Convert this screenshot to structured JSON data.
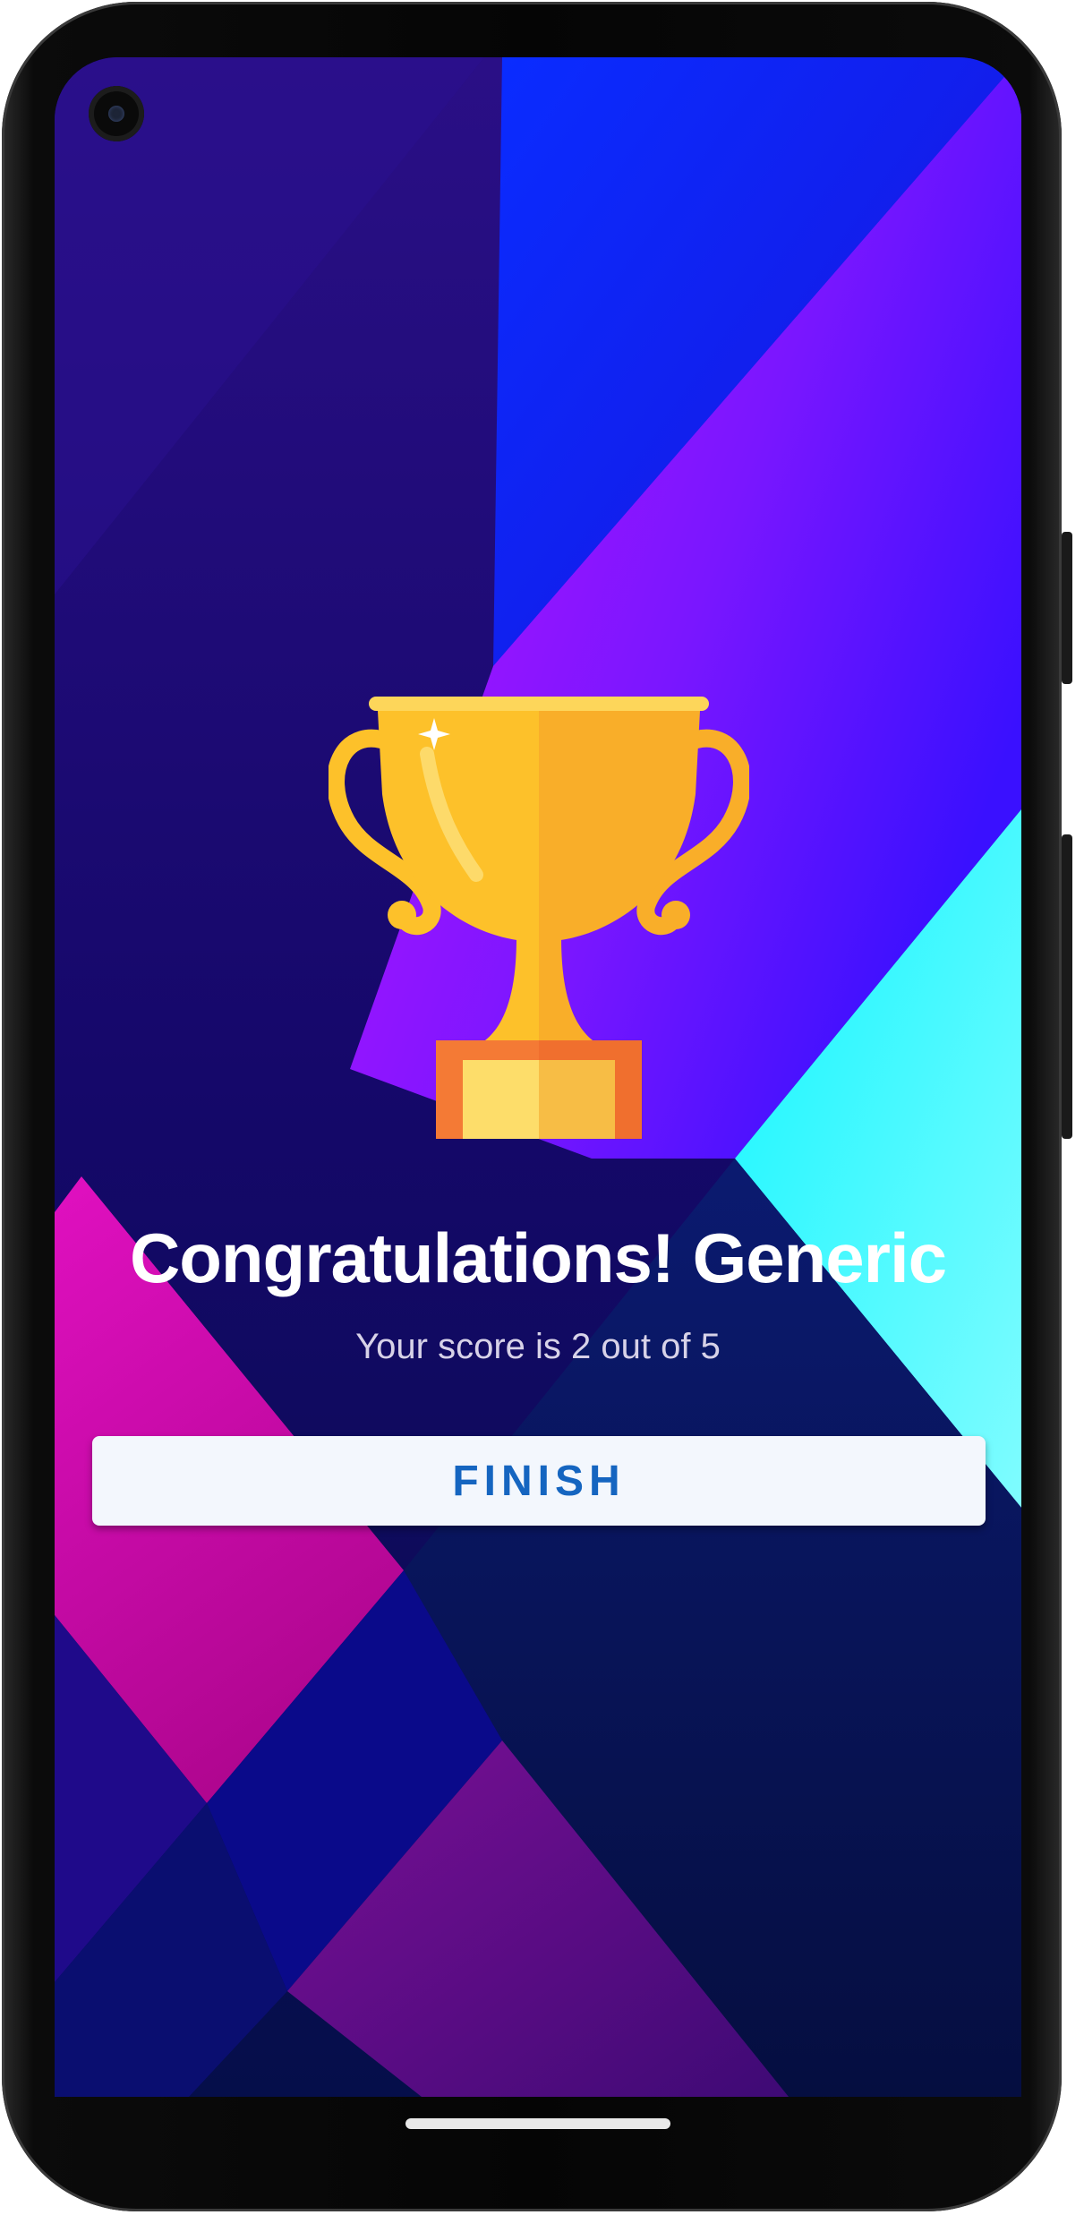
{
  "screen": {
    "title": "Congratulations! Generic",
    "score_text": "Your score is 2 out of 5",
    "finish_label": "FINISH"
  },
  "icons": {
    "trophy": "trophy-icon",
    "camera": "front-camera",
    "home": "home-indicator"
  },
  "colors": {
    "background": "#0d0650",
    "trophy_gold": "#fdc12a",
    "trophy_base": "#f47a35",
    "button_bg": "#f3f7fd",
    "button_text": "#1565c0",
    "title_text": "#ffffff"
  }
}
